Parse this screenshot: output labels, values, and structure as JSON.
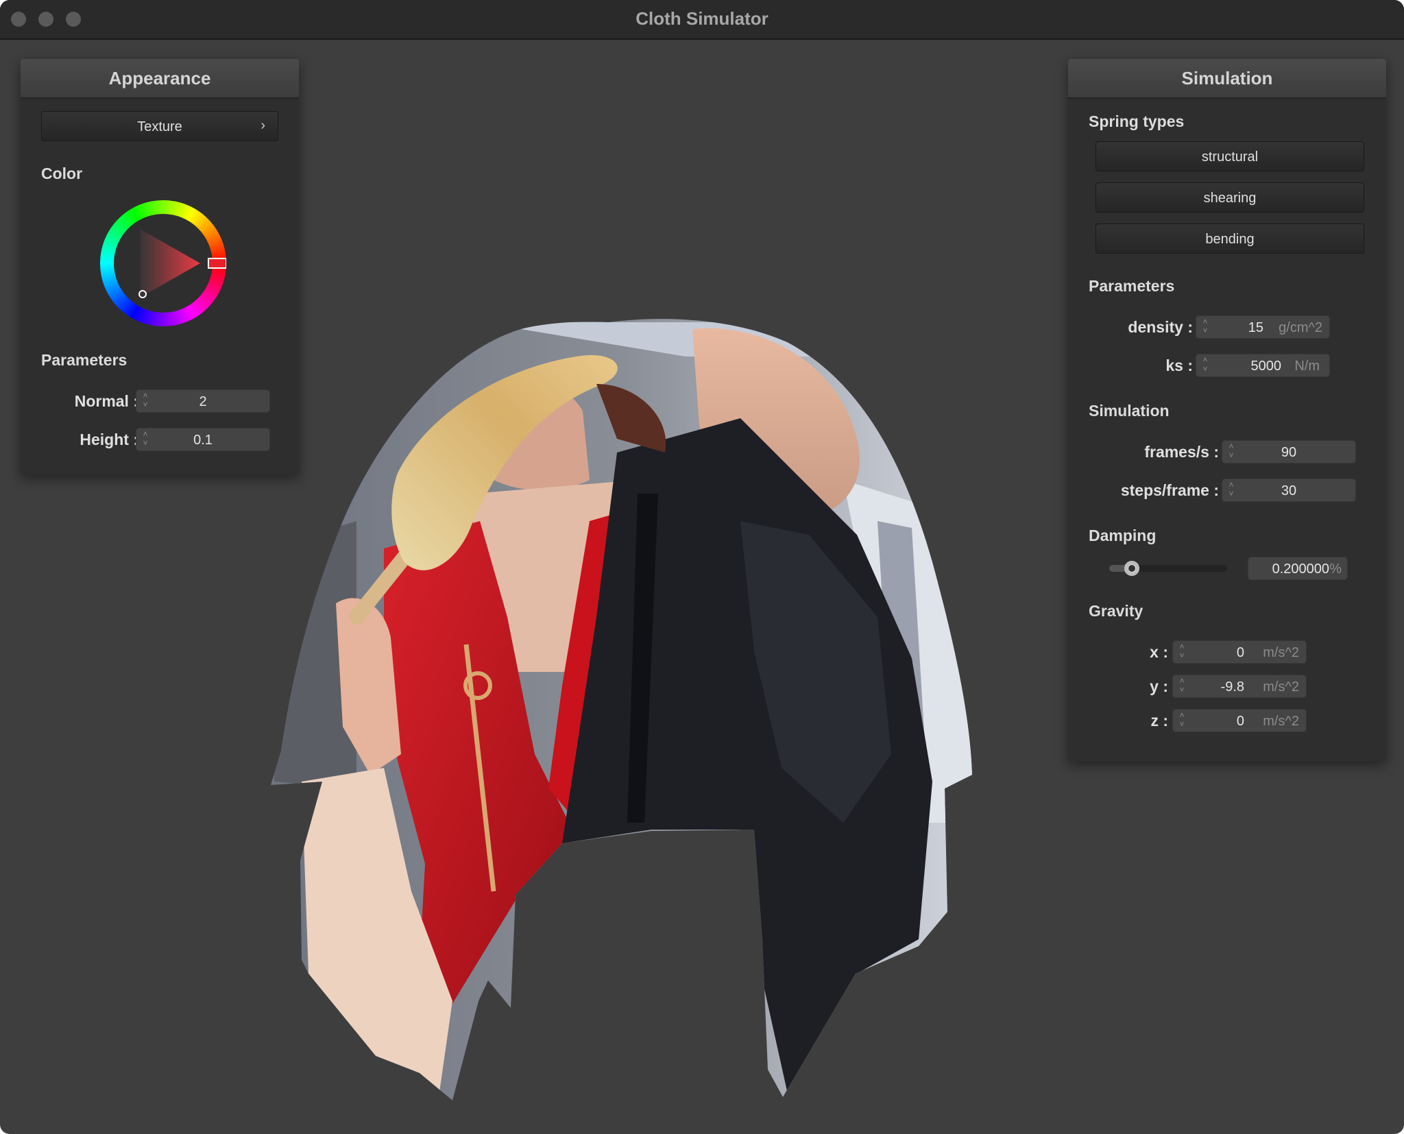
{
  "window": {
    "title": "Cloth Simulator",
    "background": "#3e3e3e"
  },
  "appearance": {
    "header": "Appearance",
    "texture_button": "Texture",
    "texture_chevron": "›",
    "color_label": "Color",
    "selected_hue": "#e8202a",
    "parameters_label": "Parameters",
    "normal": {
      "label": "Normal :",
      "value": "2"
    },
    "height": {
      "label": "Height :",
      "value": "0.1"
    }
  },
  "simulation_panel": {
    "header": "Simulation",
    "spring_types_label": "Spring types",
    "spring_buttons": [
      "structural",
      "shearing",
      "bending"
    ],
    "parameters_label": "Parameters",
    "density": {
      "label": "density :",
      "value": "15",
      "unit": "g/cm^2"
    },
    "ks": {
      "label": "ks :",
      "value": "5000",
      "unit": "N/m"
    },
    "simulation_label": "Simulation",
    "fps": {
      "label": "frames/s :",
      "value": "90"
    },
    "steps": {
      "label": "steps/frame :",
      "value": "30"
    },
    "damping_label": "Damping",
    "damping": {
      "value": "0.200000",
      "unit": "%",
      "slider_fraction": 0.2
    },
    "gravity_label": "Gravity",
    "gravity_x": {
      "label": "x :",
      "value": "0",
      "unit": "m/s^2"
    },
    "gravity_y": {
      "label": "y :",
      "value": "-9.8",
      "unit": "m/s^2"
    },
    "gravity_z": {
      "label": "z :",
      "value": "0",
      "unit": "m/s^2"
    }
  },
  "viewport": {
    "content": "cloth draped over sphere with photo texture"
  }
}
